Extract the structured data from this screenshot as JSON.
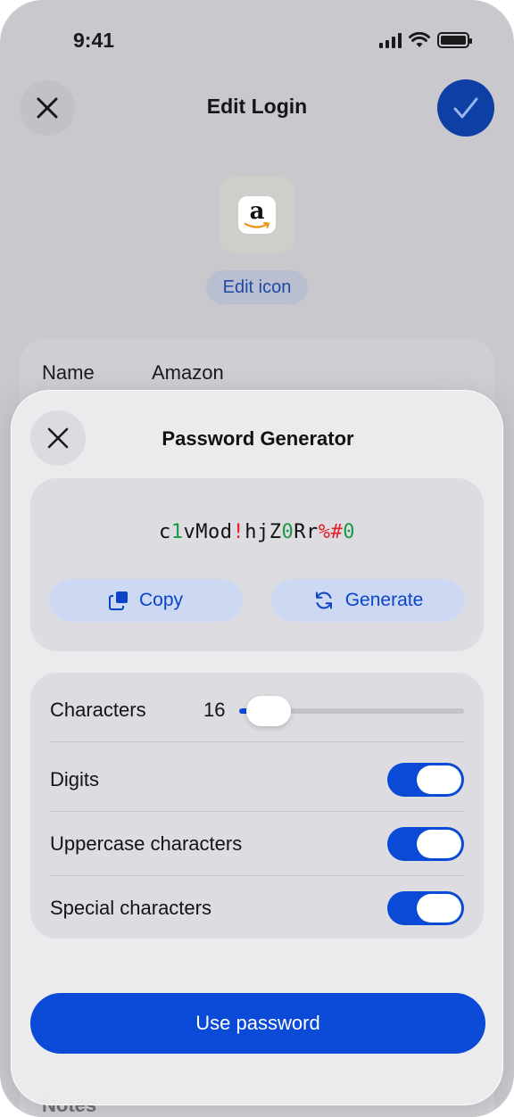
{
  "status_bar": {
    "time": "9:41"
  },
  "edit_screen": {
    "title": "Edit Login",
    "icon_letter": "a",
    "edit_icon_label": "Edit icon",
    "name_label": "Name",
    "name_value": "Amazon",
    "notes_label": "Notes"
  },
  "generator": {
    "title": "Password Generator",
    "password_segments": [
      {
        "text": "c",
        "kind": "letter"
      },
      {
        "text": "1",
        "kind": "digit"
      },
      {
        "text": "vMod",
        "kind": "letter"
      },
      {
        "text": "!",
        "kind": "special"
      },
      {
        "text": "hjZ",
        "kind": "letter"
      },
      {
        "text": "0",
        "kind": "digit"
      },
      {
        "text": "Rr",
        "kind": "letter"
      },
      {
        "text": "%#",
        "kind": "special"
      },
      {
        "text": "0",
        "kind": "digit"
      }
    ],
    "copy_label": "Copy",
    "generate_label": "Generate",
    "options": {
      "characters_label": "Characters",
      "characters_value": "16",
      "characters_fraction": 0.13,
      "digits_label": "Digits",
      "digits_on": true,
      "uppercase_label": "Uppercase characters",
      "uppercase_on": true,
      "special_label": "Special characters",
      "special_on": true
    },
    "use_button_label": "Use password"
  },
  "colors": {
    "accent": "#0a4ad6",
    "digit": "#1b9a46",
    "special": "#e0202a"
  }
}
